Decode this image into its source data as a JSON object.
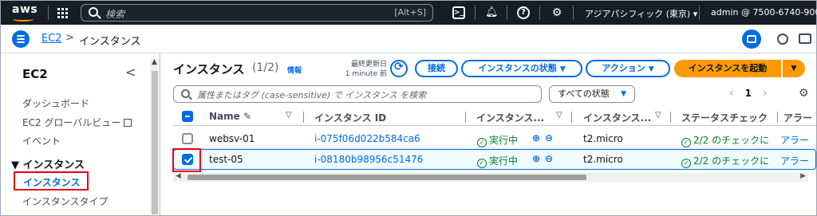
{
  "topnav": {
    "logo": "aws",
    "search_placeholder": "検索",
    "search_shortcut": "[Alt+S]",
    "region": "アジアパシフィック (東京) ▾",
    "account": "admin @ 7500-6740-9009 ▾",
    "icons": [
      "grid-icon",
      "cloudshell-icon",
      "bell-icon",
      "help-icon",
      "gear-icon"
    ]
  },
  "breadcrumb": {
    "root": "EC2",
    "separator": ">",
    "current": "インスタンス"
  },
  "sidebar": {
    "title": "EC2",
    "collapse": "<",
    "items": [
      "ダッシュボード",
      "EC2 グローバルビュー",
      "イベント"
    ],
    "section": "▼ インスタンス",
    "active_item": "インスタンス",
    "sub_item": "インスタンスタイプ"
  },
  "main": {
    "title": "インスタンス",
    "count": "(1/2)",
    "info": "情報",
    "updated_label": "最終更新日",
    "updated_value": "1 minute 前",
    "connect": "接続",
    "instance_state": "インスタンスの状態",
    "actions": "アクション",
    "launch": "インスタンスを起動",
    "filter_placeholder": "属性またはタグ (case-sensitive) で インスタンス を検索",
    "state_filter": "すべての状態",
    "page": "1"
  },
  "table": {
    "headers": [
      "Name",
      "インスタンス ID",
      "インスタンス...",
      "インスタンス...",
      "ステータスチェック",
      "アラー"
    ],
    "rows": [
      {
        "name": "websv-01",
        "id": "i-075f06d022b584ca6",
        "state": "実行中",
        "type": "t2.micro",
        "check": "2/2 のチェックに",
        "alarm": "アラー",
        "selected": false
      },
      {
        "name": "test-05",
        "id": "i-08180b98956c51476",
        "state": "実行中",
        "type": "t2.micro",
        "check": "2/2 のチェックに",
        "alarm": "アラー",
        "selected": true
      }
    ]
  },
  "colors": {
    "nav_bg": "#161d26",
    "accent": "#006ce0",
    "launch": "#ff9900",
    "success": "#00802f",
    "highlight": "#e3001b"
  }
}
